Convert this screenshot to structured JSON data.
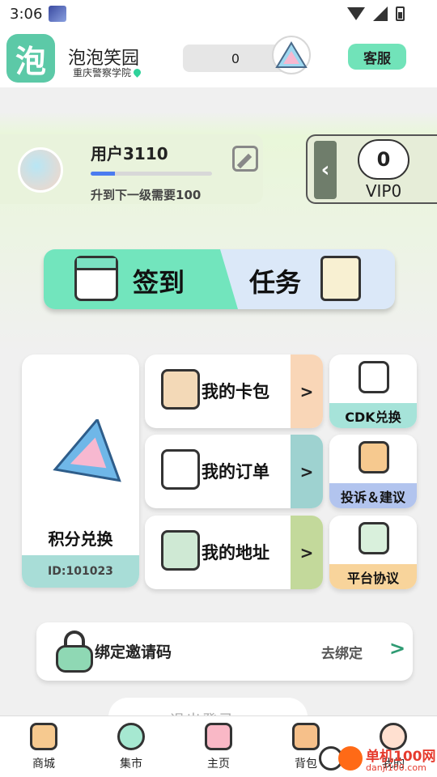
{
  "status_bar": {
    "time": "3:06"
  },
  "header": {
    "logo_char": "泡",
    "app_name": "泡泡笑园",
    "school": "重庆警察学院",
    "points": "0",
    "customer_service": "客服"
  },
  "profile": {
    "username": "用户3110",
    "level_progress": 0.2,
    "level_hint": "升到下一级需要100",
    "vip_number": "0",
    "vip_label": "VIP0"
  },
  "banner": {
    "sign_in": "签到",
    "tasks": "任务"
  },
  "features": {
    "points_exchange": {
      "title": "积分兑换",
      "id": "ID:101023"
    },
    "mid_cards": [
      {
        "label": "我的卡包",
        "arrow": ">",
        "side_color": "#f9d6b7"
      },
      {
        "label": "我的订单",
        "arrow": ">",
        "side_color": "#9ed2d0"
      },
      {
        "label": "我的地址",
        "arrow": ">",
        "side_color": "#c3d99b"
      }
    ],
    "small_cards": [
      {
        "label": "CDK兑换",
        "color": "#a6e3d9"
      },
      {
        "label": "投诉＆建议",
        "color": "#b2c4ee"
      },
      {
        "label": "平台协议",
        "color": "#f8d49b"
      }
    ]
  },
  "invite": {
    "label": "绑定邀请码",
    "action": "去绑定",
    "chevron": ">"
  },
  "peek": {
    "text": "退出登录"
  },
  "nav": [
    {
      "label": "商城",
      "icon": "shop-icon"
    },
    {
      "label": "集市",
      "icon": "chat-bubble-icon"
    },
    {
      "label": "主页",
      "icon": "home-icon"
    },
    {
      "label": "背包",
      "icon": "backpack-icon"
    },
    {
      "label": "我的",
      "icon": "profile-icon"
    }
  ],
  "watermark": {
    "text": "单机100网",
    "sub": "danji100.com"
  },
  "colors": {
    "accent": "#72e5bd",
    "logo": "#5cc9a7",
    "progress": "#4b7cf0"
  }
}
